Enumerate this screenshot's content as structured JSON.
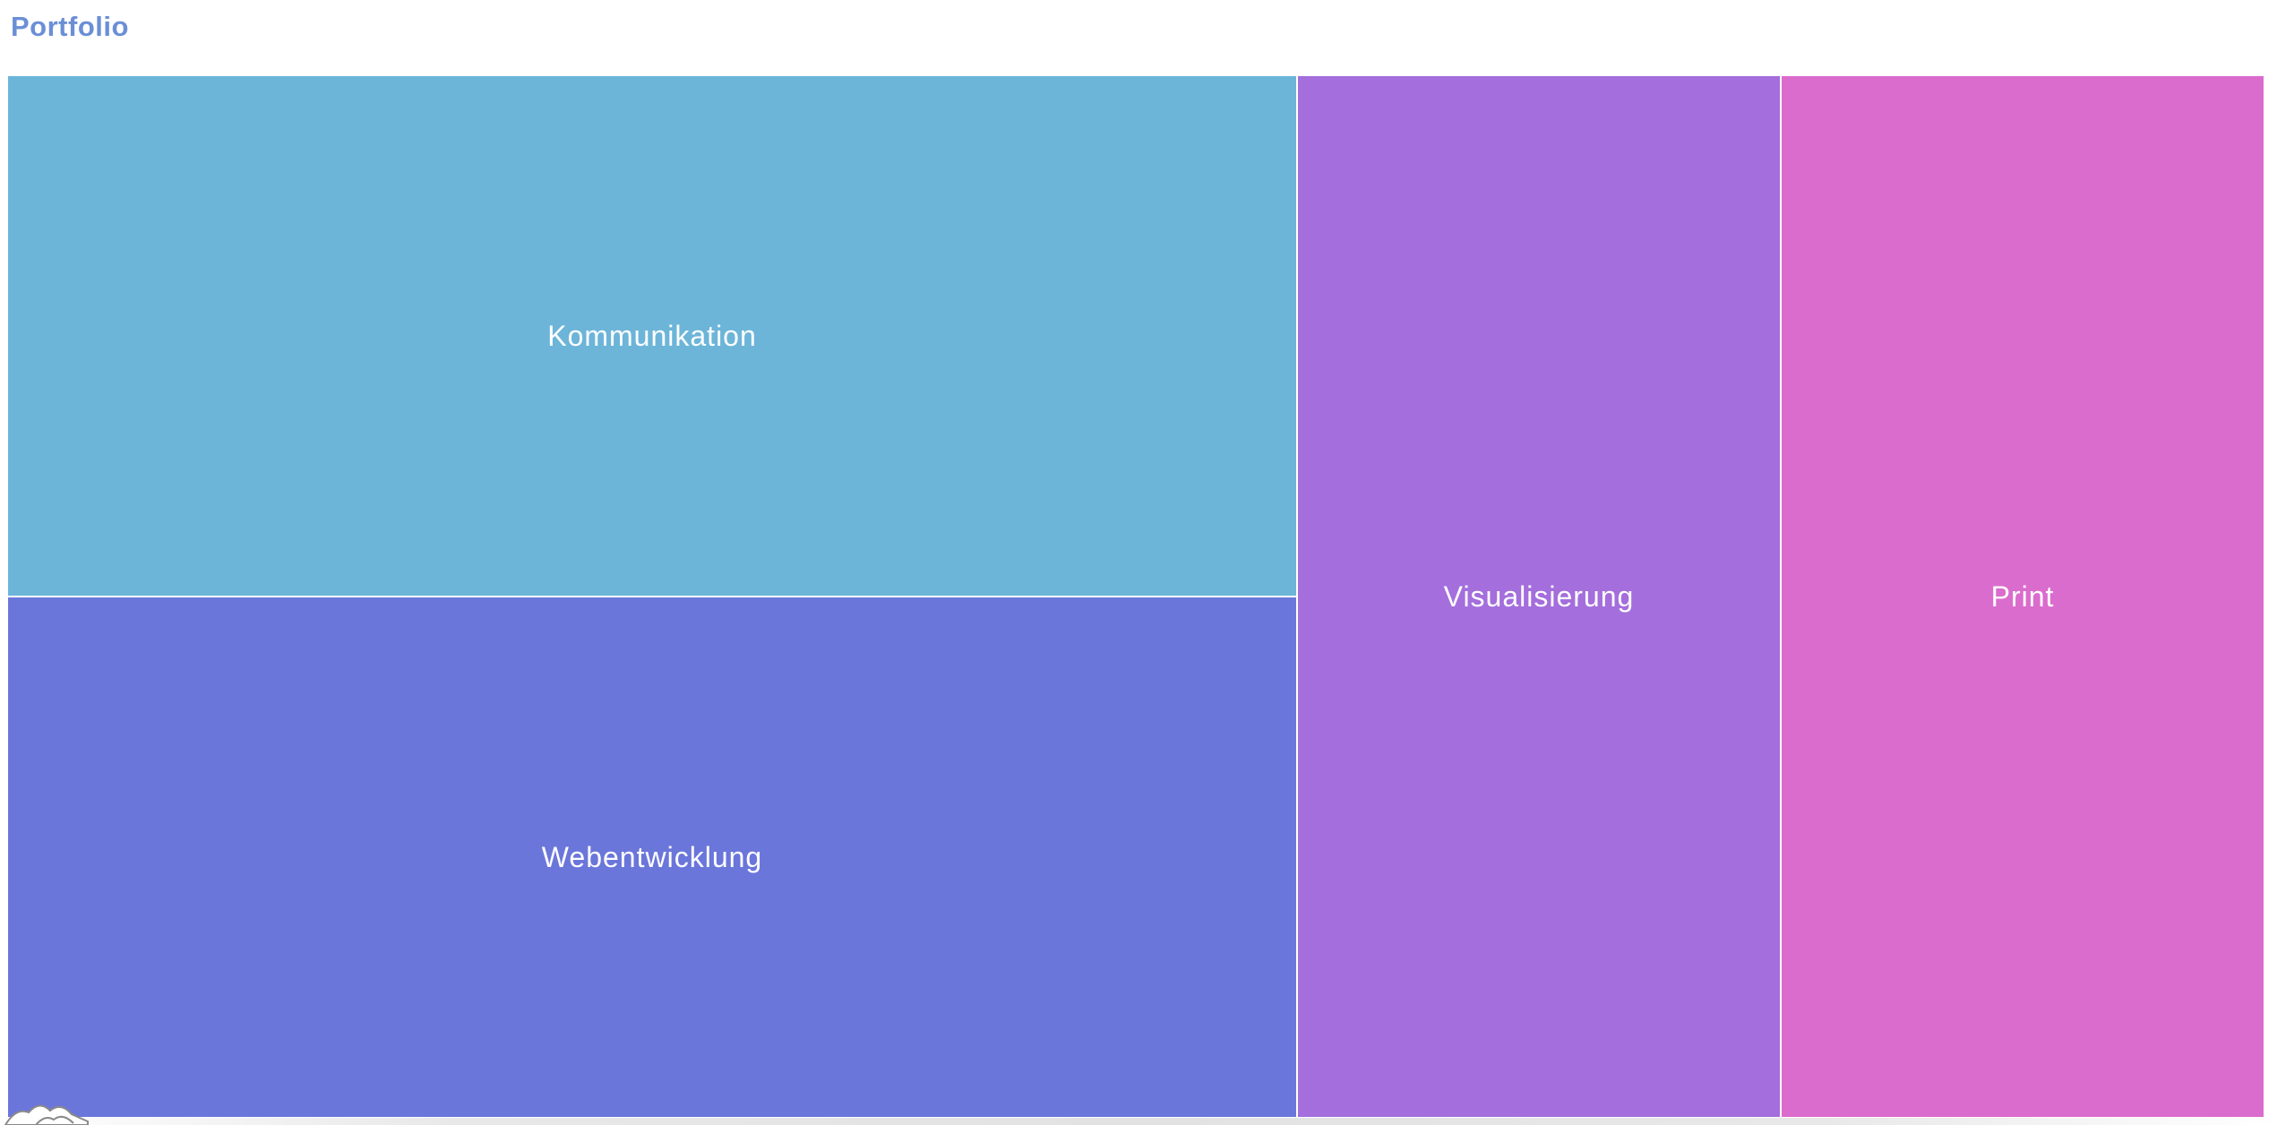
{
  "breadcrumb": {
    "label": "Portfolio"
  },
  "treemap": {
    "tiles": [
      {
        "label": "Kommunikation",
        "color": "#6cb5d9"
      },
      {
        "label": "Webentwicklung",
        "color": "#6b76db"
      },
      {
        "label": "Visualisierung",
        "color": "#a46edc"
      },
      {
        "label": "Print",
        "color": "#da6ccd"
      }
    ]
  },
  "icons": {
    "corner": "mountain-icon"
  }
}
